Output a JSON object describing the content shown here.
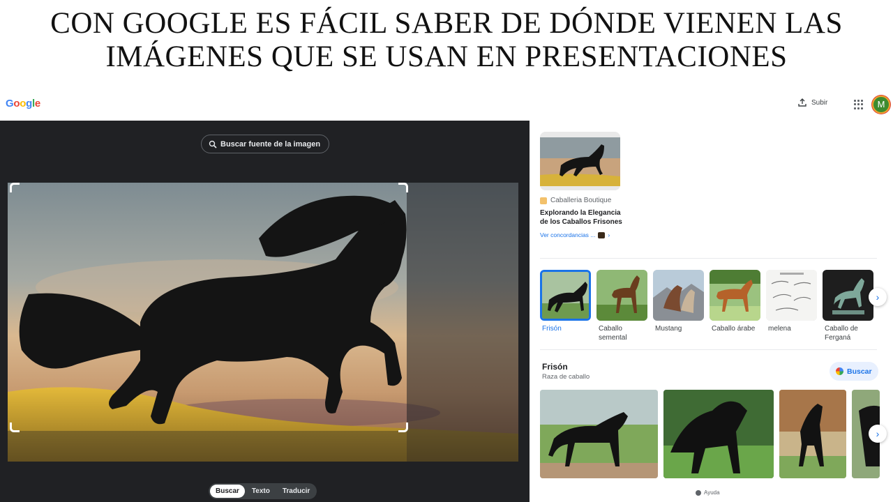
{
  "slide": {
    "title_line1": "CON GOOGLE ES FÁCIL SABER DE DÓNDE VIENEN LAS",
    "title_line2": "IMÁGENES QUE SE USAN EN PRESENTACIONES"
  },
  "topbar": {
    "logo_letters": [
      "G",
      "o",
      "o",
      "g",
      "l",
      "e"
    ],
    "logo_colors": [
      "#4285f4",
      "#ea4335",
      "#fbbc05",
      "#4285f4",
      "#34a853",
      "#ea4335"
    ],
    "upload_label": "Subir",
    "upload_icon": "upload-icon",
    "apps_icon": "apps-grid-icon",
    "avatar_letter": "M"
  },
  "lens": {
    "source_button_label": "Buscar fuente de la imagen",
    "source_button_icon": "lens-search-icon",
    "modes": [
      "Buscar",
      "Texto",
      "Traducir"
    ],
    "active_mode": "Buscar"
  },
  "results": {
    "source_card": {
      "site": "Caballeria Boutique",
      "title": "Explorando la Elegancia de los Caballos Frisones",
      "more_label": "Ver concordancias ..."
    },
    "chips": [
      {
        "label": "Frisón",
        "selected": true
      },
      {
        "label": "Caballo semental",
        "selected": false
      },
      {
        "label": "Mustang",
        "selected": false
      },
      {
        "label": "Caballo árabe",
        "selected": false
      },
      {
        "label": "melena",
        "selected": false
      },
      {
        "label": "Caballo de Ferganá",
        "selected": false
      }
    ],
    "entity": {
      "title": "Frisón",
      "subtitle": "Raza de caballo",
      "search_label": "Buscar"
    },
    "footer_help": "Ayuda"
  },
  "colors": {
    "accent": "#1a73e8",
    "dark_pane": "#202124",
    "avatar_bg": "#3d8b2f"
  }
}
